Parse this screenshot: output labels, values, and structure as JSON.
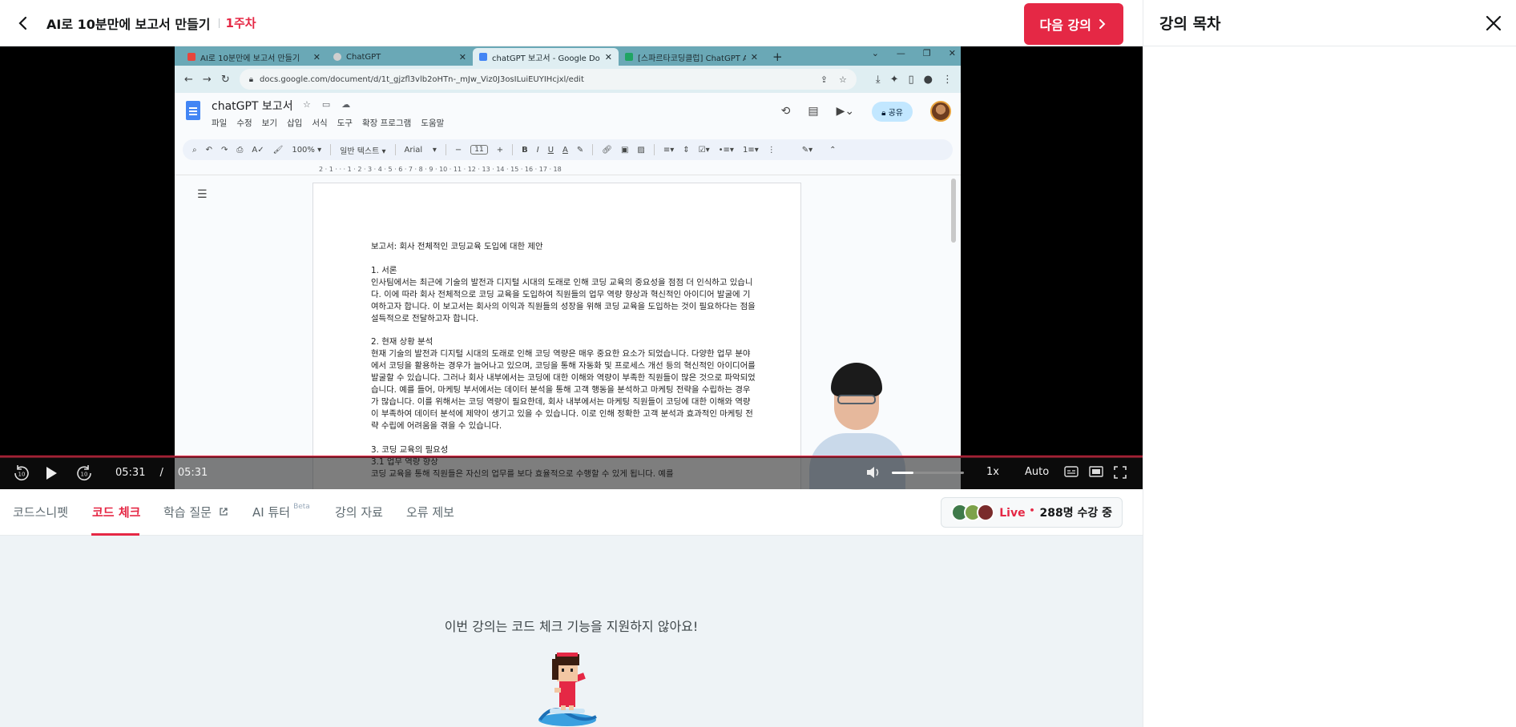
{
  "header": {
    "course_title": "AI로 10분만에 보고서 만들기",
    "week": "1주차",
    "next_button": "다음 강의"
  },
  "side_panel": {
    "title": "강의 목차"
  },
  "browser": {
    "tabs": [
      {
        "label": "AI로 10분만에 보고서 만들기",
        "color": "#e8453c"
      },
      {
        "label": "ChatGPT",
        "color": "#cfcfcf"
      },
      {
        "label": "chatGPT 보고서 - Google Docs",
        "color": "#4285f4"
      },
      {
        "label": "[스파르타코딩클럽] ChatGPT AI",
        "color": "#1fa463"
      }
    ],
    "new_tab": "+",
    "url": "docs.google.com/document/d/1t_gjzfl3vlb2oHTn-_mJw_Viz0J3osILuiEUYIHcjxl/edit"
  },
  "docs": {
    "title": "chatGPT 보고서",
    "menu": [
      "파일",
      "수정",
      "보기",
      "삽입",
      "서식",
      "도구",
      "확장 프로그램",
      "도움말"
    ],
    "share_label": "공유",
    "zoom": "100%",
    "style": "일반 텍스트",
    "font": "Arial",
    "font_size": "11",
    "ruler_numbers": "2 · 1 · · · 1 · 2 · 3 · 4 · 5 · 6 · 7 · 8 · 9 · 10 · 11 · 12 · 13 · 14 · 15 · 16 · 17 · 18",
    "paragraphs": [
      "보고서: 회사 전체적인 코딩교육 도입에 대한 제안",
      "1. 서론\n인사팀에서는 최근에 기술의 발전과 디지털 시대의 도래로 인해 코딩 교육의 중요성을 점점 더 인식하고 있습니다. 이에 따라 회사 전체적으로 코딩 교육을 도입하여 직원들의 업무 역량 향상과 혁신적인 아이디어 발굴에 기여하고자 합니다. 이 보고서는 회사의 이익과 직원들의 성장을 위해 코딩 교육을 도입하는 것이 필요하다는 점을 설득적으로 전달하고자 합니다.",
      "2. 현재 상황 분석\n현재 기술의 발전과 디지털 시대의 도래로 인해 코딩 역량은 매우 중요한 요소가 되었습니다. 다양한 업무 분야에서 코딩을 활용하는 경우가 늘어나고 있으며, 코딩을 통해 자동화 및 프로세스 개선 등의 혁신적인 아이디어를 발굴할 수 있습니다. 그러나 회사 내부에서는 코딩에 대한 이해와 역량이 부족한 직원들이 많은 것으로 파악되었습니다. 예를 들어, 마케팅 부서에서는 데이터 분석을 통해 고객 행동을 분석하고 마케팅 전략을 수립하는 경우가 많습니다. 이를 위해서는 코딩 역량이 필요한데, 회사 내부에서는 마케팅 직원들이 코딩에 대한 이해와 역량이 부족하여 데이터 분석에 제약이 생기고 있을 수 있습니다. 이로 인해 정확한 고객 분석과 효과적인 마케팅 전략 수립에 어려움을 겪을 수 있습니다.",
      "3. 코딩 교육의 필요성\n3.1 업무 역량 향상\n코딩 교육을 통해 직원들은 자신의 업무를 보다 효율적으로 수행할 수 있게 됩니다. 예를"
    ]
  },
  "player": {
    "current_time": "05:31",
    "time_separator": "/",
    "duration": "05:31",
    "progress": 1.0,
    "volume": 0.3,
    "speed": "1x",
    "quality": "Auto"
  },
  "lecture_tabs": {
    "items": [
      {
        "label": "코드스니펫"
      },
      {
        "label": "코드 체크",
        "active": true
      },
      {
        "label": "학습 질문"
      },
      {
        "label": "AI 튜터",
        "badge": "Beta"
      },
      {
        "label": "강의 자료"
      },
      {
        "label": "오류 제보"
      }
    ],
    "live_label": "Live",
    "live_dot": "•",
    "viewer_count": "288명 수강 중"
  },
  "content": {
    "notice": "이번 강의는 코드 체크 기능을 지원하지 않아요!"
  },
  "colors": {
    "accent": "#e52845",
    "panel_bg": "#eef3f6"
  }
}
